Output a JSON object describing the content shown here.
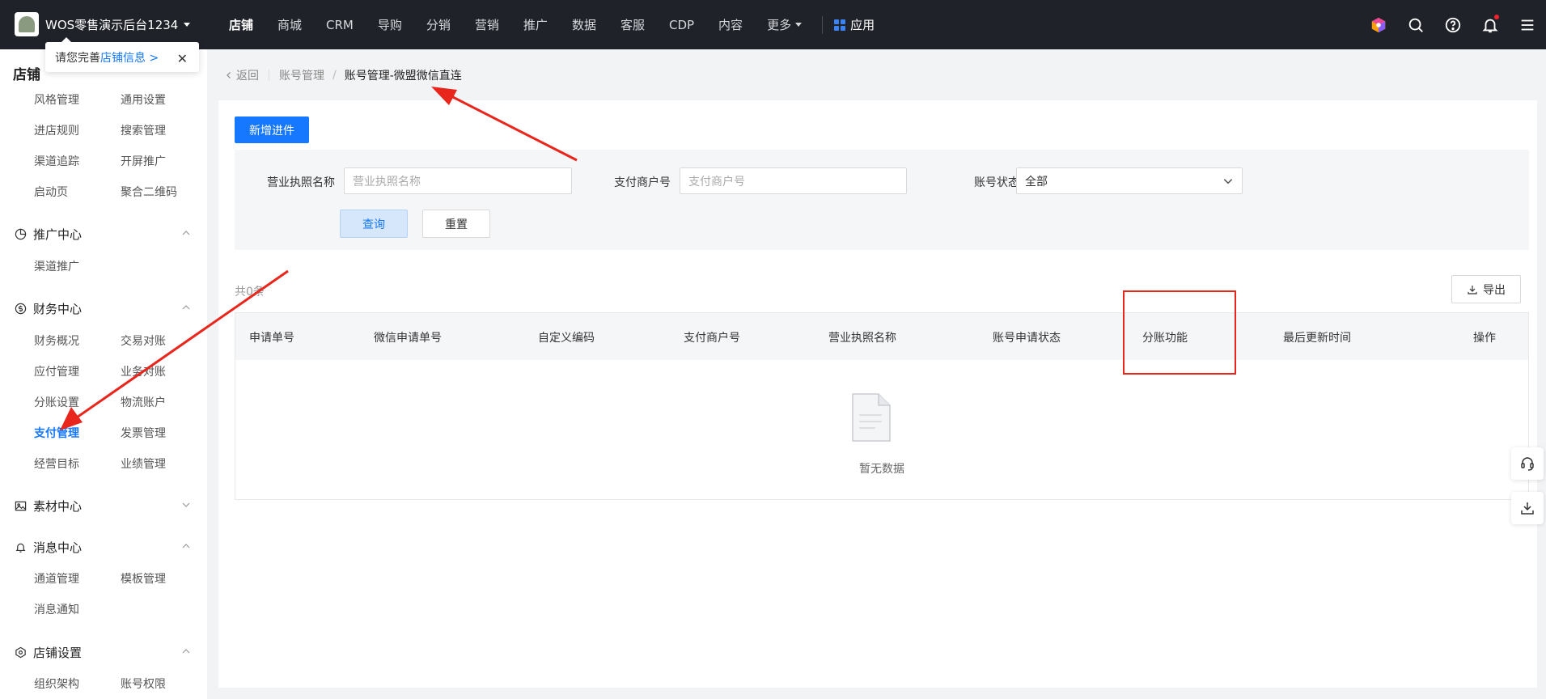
{
  "topbar": {
    "store_name": "WOS零售演示后台1234",
    "nav": [
      "店铺",
      "商城",
      "CRM",
      "导购",
      "分销",
      "营销",
      "推广",
      "数据",
      "客服",
      "CDP",
      "内容",
      "更多"
    ],
    "app_label": "应用"
  },
  "popover": {
    "prefix": "请您完善",
    "link": "店铺信息 >"
  },
  "sidebar": {
    "title": "店铺",
    "top_items": [
      "风格管理",
      "通用设置",
      "进店规则",
      "搜索管理",
      "渠道追踪",
      "开屏推广",
      "启动页",
      "聚合二维码"
    ],
    "promo": {
      "title": "推广中心",
      "items": [
        "渠道推广"
      ]
    },
    "finance": {
      "title": "财务中心",
      "items": [
        "财务概况",
        "交易对账",
        "应付管理",
        "业务对账",
        "分账设置",
        "物流账户",
        "支付管理",
        "发票管理",
        "经营目标",
        "业绩管理"
      ]
    },
    "material": {
      "title": "素材中心"
    },
    "message": {
      "title": "消息中心",
      "items": [
        "通道管理",
        "模板管理",
        "消息通知"
      ]
    },
    "store_settings": {
      "title": "店铺设置",
      "items": [
        "组织架构",
        "账号权限"
      ]
    }
  },
  "breadcrumb": {
    "back": "返回",
    "parent": "账号管理",
    "current": "账号管理-微盟微信直连"
  },
  "actions": {
    "new_button": "新增进件",
    "query": "查询",
    "reset": "重置",
    "export": "导出"
  },
  "filters": {
    "license_label": "营业执照名称",
    "license_placeholder": "营业执照名称",
    "merchant_label": "支付商户号",
    "merchant_placeholder": "支付商户号",
    "status_label": "账号状态",
    "status_value": "全部"
  },
  "table": {
    "count": "共0条",
    "columns": [
      "申请单号",
      "微信申请单号",
      "自定义编码",
      "支付商户号",
      "营业执照名称",
      "账号申请状态",
      "分账功能",
      "最后更新时间",
      "操作"
    ],
    "empty_text": "暂无数据"
  },
  "colors": {
    "accent": "#1677ff",
    "topbar": "#1f2229",
    "highlight": "#e8261c"
  }
}
